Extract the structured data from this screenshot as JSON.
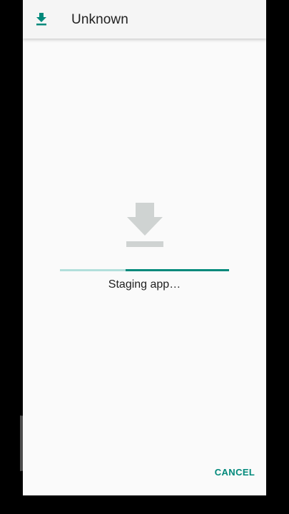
{
  "app_bar": {
    "title": "Unknown",
    "icon": "download-icon"
  },
  "main": {
    "icon": "download-icon",
    "status": "Staging app…",
    "progress_secondary": 1.0,
    "progress_primary_start": 0.39
  },
  "actions": {
    "cancel_label": "CANCEL"
  },
  "colors": {
    "accent": "#00897b",
    "accent_light": "#b2dfdb",
    "icon_gray": "#cfd3d2",
    "background": "#fafafa",
    "app_bar": "#f5f5f5"
  }
}
